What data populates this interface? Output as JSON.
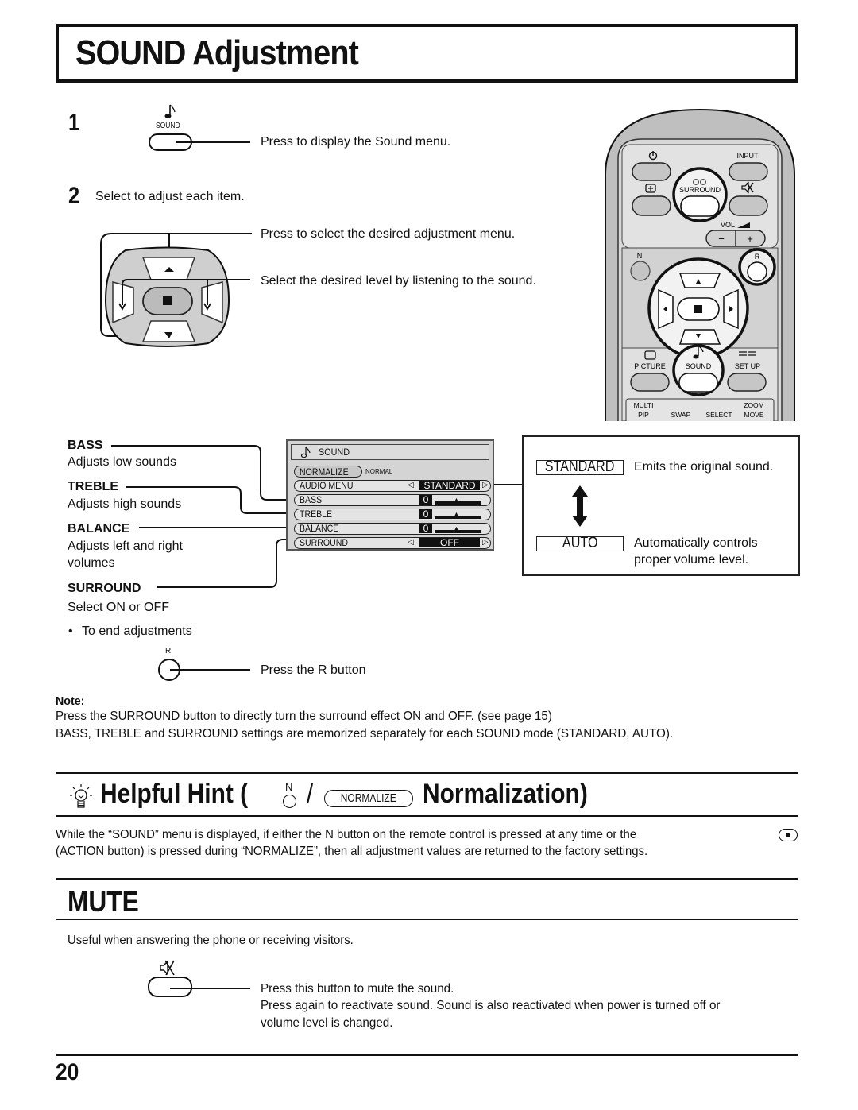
{
  "page": {
    "title": "SOUND Adjustment",
    "page_number": "20"
  },
  "steps": [
    {
      "number": "1",
      "button_label": "SOUND",
      "button_icon": "music-note-icon",
      "description": "Press to display the Sound menu."
    },
    {
      "number": "2",
      "description": "Select to adjust each item.",
      "callouts": [
        "Press to select the desired adjustment menu.",
        "Select the desired level by listening to the sound."
      ]
    }
  ],
  "remote": {
    "buttons": {
      "power": "power-icon",
      "input": "INPUT",
      "surround": "SURROUND",
      "picture_in_picture": "pip-icon",
      "mute": "mute-icon",
      "vol": "VOL",
      "vol_minus": "−",
      "vol_plus": "+",
      "n": "N",
      "r": "R",
      "picture": "PICTURE",
      "sound": "SOUND",
      "setup": "SET UP",
      "multi": "MULTI",
      "pip": "PIP",
      "swap": "SWAP",
      "select": "SELECT",
      "zoom": "ZOOM",
      "move": "MOVE"
    }
  },
  "items": [
    {
      "name": "BASS",
      "desc": "Adjusts low sounds"
    },
    {
      "name": "TREBLE",
      "desc": "Adjusts high sounds"
    },
    {
      "name": "BALANCE",
      "desc": "Adjusts left and right volumes",
      "desc_line1": "Adjusts left and right",
      "desc_line2": "volumes"
    },
    {
      "name": "SURROUND",
      "desc": "Select ON or OFF"
    }
  ],
  "end_adjust": {
    "bullet": "•",
    "text": "To end adjustments",
    "button_label": "R",
    "description": "Press the R button"
  },
  "osd": {
    "header": "SOUND",
    "normalize": "NORMALIZE",
    "normalize_state": "NORMAL",
    "rows": [
      {
        "label": "AUDIO  MENU",
        "value": "STANDARD"
      },
      {
        "label": "BASS",
        "value": "0",
        "level": 0
      },
      {
        "label": "TREBLE",
        "value": "0",
        "level": 0
      },
      {
        "label": "BALANCE",
        "value": "0",
        "level": 0
      },
      {
        "label": "SURROUND",
        "value": "OFF"
      }
    ]
  },
  "modes": [
    {
      "chip": "STANDARD",
      "desc": "Emits the original sound."
    },
    {
      "chip": "AUTO",
      "desc_line1": "Automatically controls",
      "desc_line2": "proper volume level."
    }
  ],
  "note": {
    "heading": "Note:",
    "lines": [
      "Press the SURROUND button to directly turn the surround effect ON and OFF. (see page 15)",
      "BASS, TREBLE and SURROUND settings are memorized separately for each SOUND mode (STANDARD, AUTO)."
    ]
  },
  "hint": {
    "prefix": "Helpful Hint (",
    "n_label": "N",
    "slash": "/",
    "normalize_chip": "NORMALIZE",
    "suffix": "Normalization)",
    "line1": "While the “SOUND” menu is displayed, if either the N button on the remote control is pressed at any time or the",
    "line2": "(ACTION button) is pressed during “NORMALIZE”, then all adjustment values are returned to the factory settings."
  },
  "mute": {
    "heading": "MUTE",
    "intro": "Useful when answering the phone or receiving visitors.",
    "line1": "Press this button to mute the sound.",
    "line2": "Press again to reactivate sound. Sound is also reactivated when power is turned off or",
    "line3": "volume level is changed."
  }
}
